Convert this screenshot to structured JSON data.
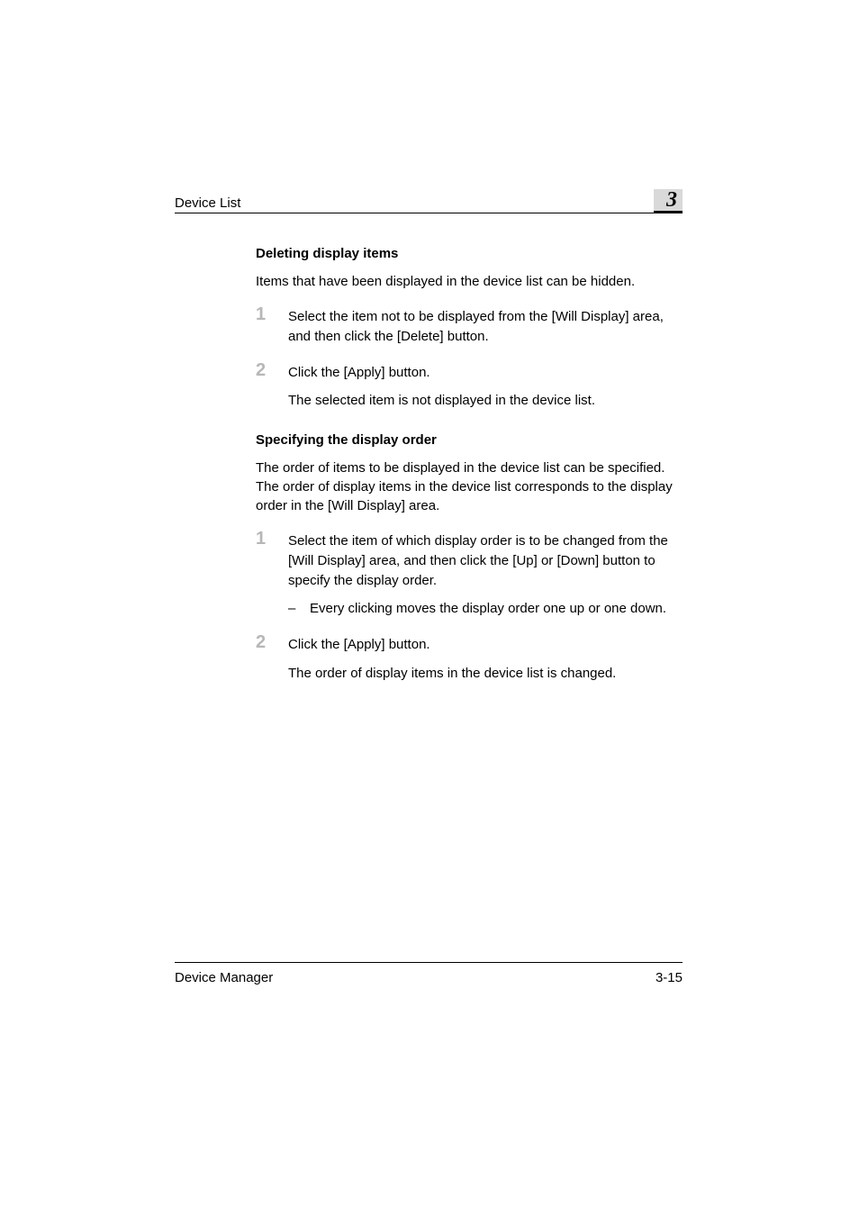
{
  "header": {
    "title": "Device List",
    "chapter_number": "3"
  },
  "sections": [
    {
      "heading": "Deleting display items",
      "intro": "Items that have been displayed in the device list can be hidden.",
      "steps": [
        {
          "num": "1",
          "text": "Select the item not to be displayed from the [Will Display] area, and then click the [Delete] button."
        },
        {
          "num": "2",
          "text": "Click the [Apply] button.",
          "result": "The selected item is not displayed in the device list."
        }
      ]
    },
    {
      "heading": "Specifying the display order",
      "intro": "The order of items to be displayed in the device list can be specified. The order of display items in the device list corresponds to the display order in the [Will Display] area.",
      "steps": [
        {
          "num": "1",
          "text": "Select the item of which display order is to be changed from the [Will Display] area, and then click the [Up] or [Down] button to specify the display order.",
          "sub": "Every clicking moves the display order one up or one down."
        },
        {
          "num": "2",
          "text": "Click the [Apply] button.",
          "result": "The order of display items in the device list is changed."
        }
      ]
    }
  ],
  "footer": {
    "left": "Device Manager",
    "right": "3-15"
  }
}
